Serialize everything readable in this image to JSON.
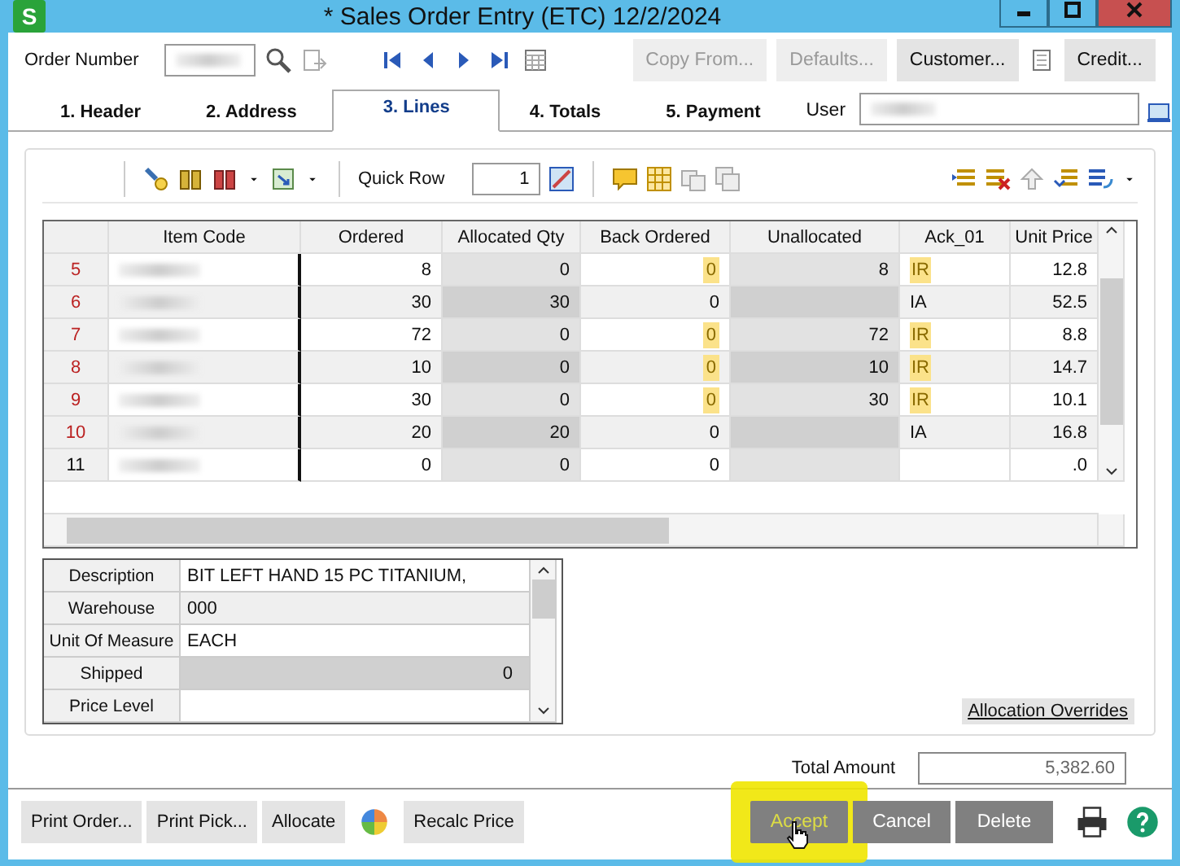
{
  "window": {
    "title": "* Sales Order Entry (ETC) 12/2/2024",
    "app_letter": "S"
  },
  "order_number_label": "Order Number",
  "top_buttons": [
    {
      "label": "Copy From...",
      "disabled": true
    },
    {
      "label": "Defaults...",
      "disabled": true
    },
    {
      "label": "Customer...",
      "disabled": false
    },
    {
      "label": "Credit...",
      "disabled": false
    }
  ],
  "tabs": [
    {
      "label": "1. Header",
      "selected": false
    },
    {
      "label": "2. Address",
      "selected": false
    },
    {
      "label": "3. Lines",
      "selected": true
    },
    {
      "label": "4. Totals",
      "selected": false
    },
    {
      "label": "5. Payment",
      "selected": false
    }
  ],
  "user_label": "User",
  "quick_row": {
    "label": "Quick Row",
    "value": "1"
  },
  "table": {
    "columns": [
      "Item Code",
      "Ordered",
      "Allocated Qty",
      "Back Ordered",
      "Unallocated",
      "Ack_01",
      "Unit Price"
    ],
    "rows": [
      {
        "line": "5",
        "flagged": true,
        "ordered": "8",
        "allocated": "0",
        "back_ordered": "0",
        "unallocated": "8",
        "ack": "IR",
        "highlighted": true,
        "unit_price": "12.8"
      },
      {
        "line": "6",
        "flagged": true,
        "ordered": "30",
        "allocated": "30",
        "back_ordered": "0",
        "ack": "IA",
        "highlighted": false,
        "unit_price": "52.5"
      },
      {
        "line": "7",
        "flagged": true,
        "ordered": "72",
        "allocated": "0",
        "back_ordered": "0",
        "unallocated": "72",
        "ack": "IR",
        "highlighted": true,
        "unit_price": "8.8"
      },
      {
        "line": "8",
        "flagged": true,
        "ordered": "10",
        "allocated": "0",
        "back_ordered": "0",
        "unallocated": "10",
        "ack": "IR",
        "highlighted": true,
        "unit_price": "14.7"
      },
      {
        "line": "9",
        "flagged": true,
        "ordered": "30",
        "allocated": "0",
        "back_ordered": "0",
        "unallocated": "30",
        "ack": "IR",
        "highlighted": true,
        "unit_price": "10.1"
      },
      {
        "line": "10",
        "flagged": true,
        "ordered": "20",
        "allocated": "20",
        "back_ordered": "0",
        "ack": "IA",
        "highlighted": false,
        "unit_price": "16.8"
      },
      {
        "line": "11",
        "flagged": false,
        "ordered": "0",
        "allocated": "0",
        "back_ordered": "0",
        "highlighted": false,
        "unit_price": ".0"
      }
    ]
  },
  "details": [
    {
      "label": "Description",
      "value": "BIT LEFT HAND 15 PC TITANIUM,",
      "kind": "text"
    },
    {
      "label": "Warehouse",
      "value": "000",
      "kind": "text"
    },
    {
      "label": "Unit Of Measure",
      "value": "EACH",
      "kind": "text"
    },
    {
      "label": "Shipped",
      "value": "0",
      "kind": "number"
    },
    {
      "label": "Price Level",
      "kind": "text"
    }
  ],
  "allocation_overrides": "Allocation Overrides",
  "total": {
    "label": "Total Amount",
    "value": "5,382.60"
  },
  "bottom_left_buttons": [
    "Print Order...",
    "Print Pick...",
    "Allocate",
    "Recalc Price"
  ],
  "bottom_right_buttons": [
    {
      "label": "Accept",
      "highlighted": true
    },
    {
      "label": "Cancel",
      "highlighted": false
    },
    {
      "label": "Delete",
      "highlighted": false
    }
  ]
}
